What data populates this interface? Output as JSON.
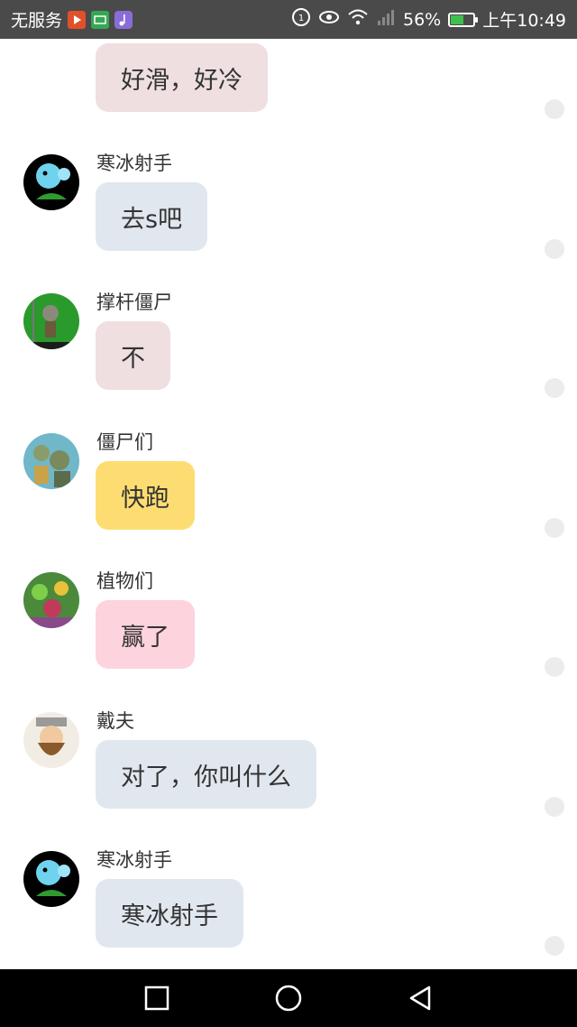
{
  "status_bar": {
    "carrier": "无服务",
    "battery_percent": "56%",
    "battery_level": 0.56,
    "time": "上午10:49",
    "icons": [
      "video-app-icon",
      "green-app-icon",
      "music-app-icon",
      "hd-icon",
      "eye-icon",
      "wifi-icon",
      "signal-icon",
      "battery-icon"
    ]
  },
  "messages": [
    {
      "sender": "",
      "text": "好滑，好冷",
      "bubble_color": "#efdfe0",
      "avatar": "pole-vaulting-zombie"
    },
    {
      "sender": "寒冰射手",
      "text": "去s吧",
      "bubble_color": "#e1e7ef",
      "avatar": "snow-pea"
    },
    {
      "sender": "撑杆僵尸",
      "text": "不",
      "bubble_color": "#efdfe0",
      "avatar": "pole-vaulting-zombie"
    },
    {
      "sender": "僵尸们",
      "text": "快跑",
      "bubble_color": "#fddd72",
      "avatar": "zombies-group"
    },
    {
      "sender": "植物们",
      "text": "赢了",
      "bubble_color": "#fdd3dd",
      "avatar": "plants-group"
    },
    {
      "sender": "戴夫",
      "text": "对了，你叫什么",
      "bubble_color": "#e1e7ef",
      "avatar": "crazy-dave"
    },
    {
      "sender": "寒冰射手",
      "text": "寒冰射手",
      "bubble_color": "#e1e7ef",
      "avatar": "snow-pea"
    }
  ],
  "navbar": {
    "buttons": [
      "recent-apps-button",
      "home-button",
      "back-button"
    ]
  }
}
